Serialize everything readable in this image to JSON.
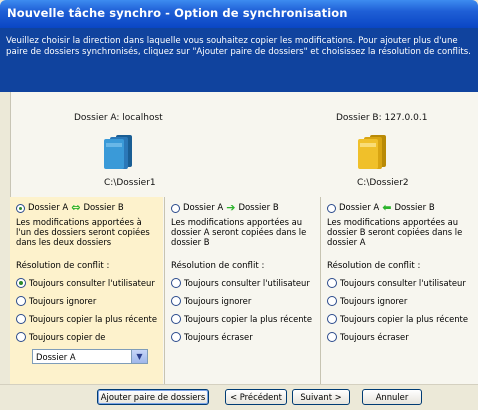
{
  "window": {
    "title": "Nouvelle tâche synchro - Option de synchronisation"
  },
  "banner": {
    "instructions": "Veuillez choisir la direction dans laquelle vous souhaitez copier les modifications. Pour ajouter plus d'une paire de dossiers synchronisés, cliquez sur \"Ajouter paire de dossiers\" et choisissez la résolution de conflits."
  },
  "folders": {
    "a": {
      "label": "Dossier A: localhost",
      "path": "C:\\Dossier1",
      "icon": "blue-folder-icon",
      "color": "#2f86c9"
    },
    "b": {
      "label": "Dossier B: 127.0.0.1",
      "path": "C:\\Dossier2",
      "icon": "yellow-folder-icon",
      "color": "#e8b51a"
    }
  },
  "options": [
    {
      "label_a": "Dossier A",
      "label_b": "Dossier B",
      "arrow": "⇔",
      "selected": true,
      "description": "Les modifications apportées à l'un des dossiers seront copiées dans les deux dossiers",
      "conflict_title": "Résolution de conflit :",
      "choices": [
        {
          "label": "Toujours consulter l'utilisateur",
          "selected": true
        },
        {
          "label": "Toujours ignorer",
          "selected": false
        },
        {
          "label": "Toujours copier la plus récente",
          "selected": false
        },
        {
          "label": "Toujours copier de",
          "selected": false
        }
      ],
      "dropdown_value": "Dossier A"
    },
    {
      "label_a": "Dossier A",
      "label_b": "Dossier B",
      "arrow": "➔",
      "selected": false,
      "description": "Les modifications apportées au dossier A seront copiées dans le dossier B",
      "conflict_title": "Résolution de conflit :",
      "choices": [
        {
          "label": "Toujours consulter l'utilisateur",
          "selected": false
        },
        {
          "label": "Toujours ignorer",
          "selected": false
        },
        {
          "label": "Toujours copier la plus récente",
          "selected": false
        },
        {
          "label": "Toujours écraser",
          "selected": false
        }
      ]
    },
    {
      "label_a": "Dossier A",
      "label_b": "Dossier B",
      "arrow": "⬅",
      "selected": false,
      "description": "Les modifications apportées au dossier B seront copiées dans le dossier A",
      "conflict_title": "Résolution de conflit :",
      "choices": [
        {
          "label": "Toujours consulter l'utilisateur",
          "selected": false
        },
        {
          "label": "Toujours ignorer",
          "selected": false
        },
        {
          "label": "Toujours copier la plus récente",
          "selected": false
        },
        {
          "label": "Toujours écraser",
          "selected": false
        }
      ]
    }
  ],
  "buttons": {
    "add_pair": "Ajouter paire de dossiers",
    "previous": "< Précédent",
    "next": "Suivant >",
    "cancel": "Annuler"
  },
  "colors": {
    "banner": "#10439e",
    "highlight": "#fdf2cc",
    "arrow": "#2bb32b"
  }
}
